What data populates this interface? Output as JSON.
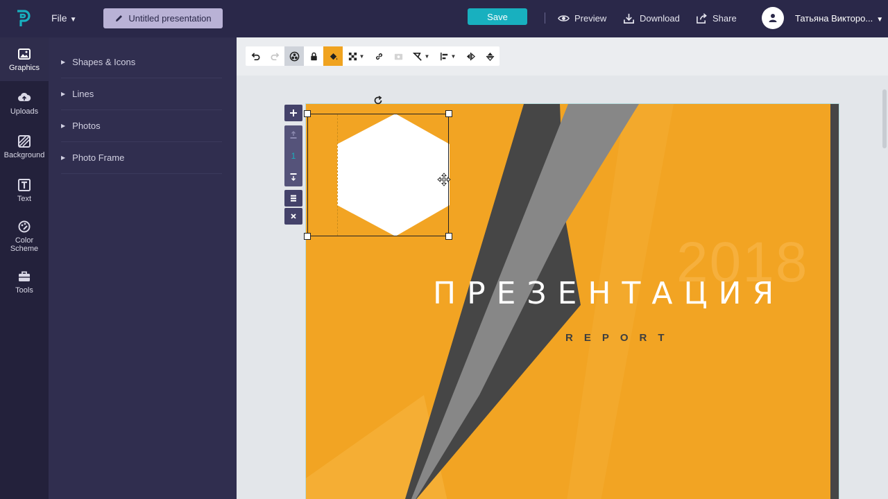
{
  "topbar": {
    "file_label": "File",
    "title_label": "Untitled presentation",
    "save_label": "Save",
    "preview_label": "Preview",
    "download_label": "Download",
    "share_label": "Share",
    "user_name": "Татьяна Викторо...",
    "accent_color": "#18b0bf",
    "bar_color": "#2a2849"
  },
  "rail": {
    "items": [
      {
        "label": "Graphics",
        "icon": "image-icon"
      },
      {
        "label": "Uploads",
        "icon": "cloud-upload-icon"
      },
      {
        "label": "Background",
        "icon": "hatched-square-icon"
      },
      {
        "label": "Text",
        "icon": "text-icon"
      },
      {
        "label": "Color\nScheme",
        "line1": "Color",
        "line2": "Scheme",
        "icon": "palette-icon"
      },
      {
        "label": "Tools",
        "icon": "toolbox-icon"
      }
    ]
  },
  "panel": {
    "items": [
      {
        "label": "Shapes & Icons"
      },
      {
        "label": "Lines"
      },
      {
        "label": "Photos"
      },
      {
        "label": "Photo Frame"
      }
    ]
  },
  "toolbar": {
    "buttons": [
      "undo-icon",
      "redo-icon",
      "color-wheel-icon",
      "lock-icon",
      "fill-bucket-icon",
      "transparency-icon",
      "link-icon",
      "image-replace-icon",
      "shape-outline-icon",
      "align-icon",
      "flip-horizontal-icon",
      "flip-vertical-icon"
    ],
    "fill_color": "#f0a320"
  },
  "side_tools": {
    "layer_number": "1"
  },
  "slide": {
    "background_color": "#f2a423",
    "year": "2018",
    "title": "ПРЕЗЕНТАЦИЯ",
    "subtitle": "REPORT"
  }
}
